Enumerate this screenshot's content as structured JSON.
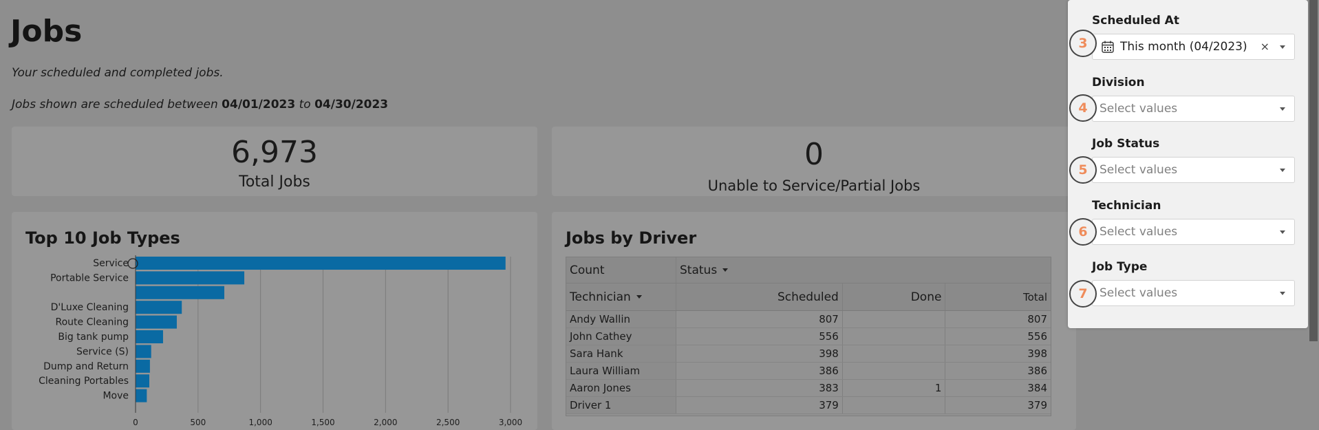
{
  "page": {
    "title": "Jobs",
    "subtitle": "Your scheduled and completed jobs.",
    "range_prefix": "Jobs shown are scheduled between",
    "range_start": "04/01/2023",
    "range_mid": "to",
    "range_end": "04/30/2023"
  },
  "kpis": [
    {
      "value": "6,973",
      "label": "Total Jobs"
    },
    {
      "value": "0",
      "label": "Unable to Service/Partial Jobs"
    }
  ],
  "job_types_chart": {
    "title": "Top 10 Job Types"
  },
  "chart_data": {
    "type": "bar",
    "orientation": "horizontal",
    "title": "Top 10 Job Types",
    "categories": [
      "Service",
      "Portable Service",
      "",
      "D'Luxe Cleaning",
      "Route Cleaning",
      "Big tank pump",
      "Service (S)",
      "Dump and Return",
      "Cleaning Portables",
      "Move"
    ],
    "values": [
      2960,
      870,
      710,
      370,
      330,
      220,
      125,
      115,
      110,
      90
    ],
    "xlim": [
      0,
      3000
    ],
    "xticks": [
      0,
      500,
      1000,
      1500,
      2000,
      2500,
      3000
    ],
    "xtick_labels": [
      "0",
      "500",
      "1,000",
      "1,500",
      "2,000",
      "2,500",
      "3,000"
    ],
    "grid": true,
    "bar_color": "#0a6aa3"
  },
  "driver_table": {
    "title": "Jobs by Driver",
    "count_label": "Count",
    "status_label": "Status",
    "technician_label": "Technician",
    "col_scheduled": "Scheduled",
    "col_done": "Done",
    "col_total": "Total",
    "rows": [
      {
        "technician": "Andy Wallin",
        "scheduled": "807",
        "done": "",
        "total": "807"
      },
      {
        "technician": "John Cathey",
        "scheduled": "556",
        "done": "",
        "total": "556"
      },
      {
        "technician": "Sara Hank",
        "scheduled": "398",
        "done": "",
        "total": "398"
      },
      {
        "technician": "Laura William",
        "scheduled": "386",
        "done": "",
        "total": "386"
      },
      {
        "technician": "Aaron Jones",
        "scheduled": "383",
        "done": "1",
        "total": "384"
      },
      {
        "technician": "Driver 1",
        "scheduled": "379",
        "done": "",
        "total": "379"
      }
    ]
  },
  "filters": [
    {
      "label": "Scheduled At",
      "value": "This month (04/2023)",
      "badge": "3",
      "has_value": true
    },
    {
      "label": "Division",
      "placeholder": "Select values",
      "badge": "4"
    },
    {
      "label": "Job Status",
      "placeholder": "Select values",
      "badge": "5"
    },
    {
      "label": "Technician",
      "placeholder": "Select values",
      "badge": "6"
    },
    {
      "label": "Job Type",
      "placeholder": "Select values",
      "badge": "7"
    }
  ],
  "clear_glyph": "×"
}
